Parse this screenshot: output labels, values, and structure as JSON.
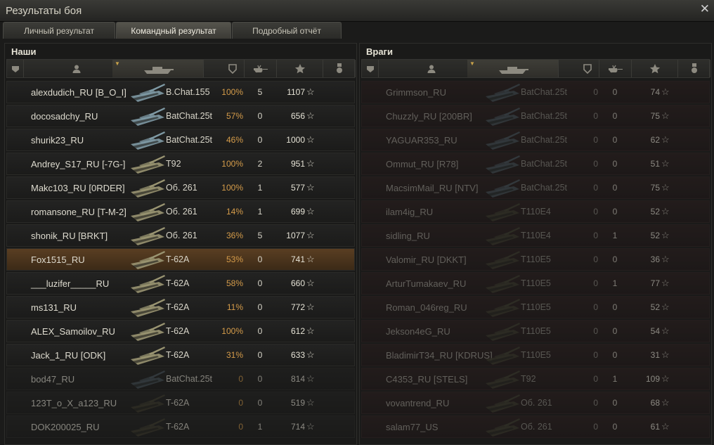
{
  "window": {
    "title": "Результаты боя"
  },
  "tabs": [
    {
      "label": "Личный результат",
      "active": false
    },
    {
      "label": "Командный результат",
      "active": true
    },
    {
      "label": "Подробный отчёт",
      "active": false
    }
  ],
  "colors": {
    "accent": "#d59c4a",
    "ally_row": "#232322",
    "enemy_row": "#2a1e1e",
    "self_row": "#5a3e22"
  },
  "header_icons": [
    "squad-icon",
    "player-icon",
    "tank-icon",
    "damage-icon",
    "frags-icon",
    "xp-star-icon",
    "medal-icon"
  ],
  "allies": {
    "label": "Наши",
    "rows": [
      {
        "name": "alexdudich_RU [B_O_I]",
        "tank": "B.Chat.155",
        "pct": "100%",
        "kills": "5",
        "xp": "1107",
        "state": "alive"
      },
      {
        "name": "docosadchy_RU",
        "tank": "BatChat.25t",
        "pct": "57%",
        "kills": "0",
        "xp": "656",
        "state": "alive"
      },
      {
        "name": "shurik23_RU",
        "tank": "BatChat.25t",
        "pct": "46%",
        "kills": "0",
        "xp": "1000",
        "state": "alive"
      },
      {
        "name": "Andrey_S17_RU [-7G-]",
        "tank": "T92",
        "pct": "100%",
        "kills": "2",
        "xp": "951",
        "state": "alive"
      },
      {
        "name": "Makc103_RU [0RDER]",
        "tank": "Об. 261",
        "pct": "100%",
        "kills": "1",
        "xp": "577",
        "state": "alive"
      },
      {
        "name": "romansone_RU [T-M-2]",
        "tank": "Об. 261",
        "pct": "14%",
        "kills": "1",
        "xp": "699",
        "state": "alive"
      },
      {
        "name": "shonik_RU [BRKT]",
        "tank": "Об. 261",
        "pct": "36%",
        "kills": "5",
        "xp": "1077",
        "state": "alive"
      },
      {
        "name": "Fox1515_RU",
        "tank": "T-62A",
        "pct": "53%",
        "kills": "0",
        "xp": "741",
        "state": "self"
      },
      {
        "name": "___luzifer_____RU",
        "tank": "T-62A",
        "pct": "58%",
        "kills": "0",
        "xp": "660",
        "state": "alive"
      },
      {
        "name": "ms131_RU",
        "tank": "T-62A",
        "pct": "11%",
        "kills": "0",
        "xp": "772",
        "state": "alive"
      },
      {
        "name": "ALEX_Samoilov_RU",
        "tank": "T-62A",
        "pct": "100%",
        "kills": "0",
        "xp": "612",
        "state": "alive"
      },
      {
        "name": "Jack_1_RU [ODK]",
        "tank": "T-62A",
        "pct": "31%",
        "kills": "0",
        "xp": "633",
        "state": "alive"
      },
      {
        "name": "bod47_RU",
        "tank": "BatChat.25t",
        "pct": "0",
        "kills": "0",
        "xp": "814",
        "state": "dead"
      },
      {
        "name": "123T_o_X_a123_RU",
        "tank": "T-62A",
        "pct": "0",
        "kills": "0",
        "xp": "519",
        "state": "dead"
      },
      {
        "name": "DOK200025_RU",
        "tank": "T-62A",
        "pct": "0",
        "kills": "1",
        "xp": "714",
        "state": "dead"
      }
    ]
  },
  "enemies": {
    "label": "Враги",
    "rows": [
      {
        "name": "Grimmson_RU",
        "tank": "BatChat.25t",
        "pct": "0",
        "kills": "0",
        "xp": "74",
        "state": "dead"
      },
      {
        "name": "Chuzzly_RU [200BR]",
        "tank": "BatChat.25t",
        "pct": "0",
        "kills": "0",
        "xp": "75",
        "state": "dead"
      },
      {
        "name": "YAGUAR353_RU",
        "tank": "BatChat.25t",
        "pct": "0",
        "kills": "0",
        "xp": "62",
        "state": "dead"
      },
      {
        "name": "Ommut_RU [R78]",
        "tank": "BatChat.25t",
        "pct": "0",
        "kills": "0",
        "xp": "51",
        "state": "dead"
      },
      {
        "name": "MacsimMail_RU [NTV]",
        "tank": "BatChat.25t",
        "pct": "0",
        "kills": "0",
        "xp": "75",
        "state": "dead"
      },
      {
        "name": "ilam4ig_RU",
        "tank": "T110E4",
        "pct": "0",
        "kills": "0",
        "xp": "52",
        "state": "dead"
      },
      {
        "name": "sidling_RU",
        "tank": "T110E4",
        "pct": "0",
        "kills": "1",
        "xp": "52",
        "state": "dead"
      },
      {
        "name": "Valomir_RU [DKKT]",
        "tank": "T110E5",
        "pct": "0",
        "kills": "0",
        "xp": "36",
        "state": "dead"
      },
      {
        "name": "ArturTumakaev_RU",
        "tank": "T110E5",
        "pct": "0",
        "kills": "1",
        "xp": "77",
        "state": "dead"
      },
      {
        "name": "Roman_046reg_RU",
        "tank": "T110E5",
        "pct": "0",
        "kills": "0",
        "xp": "52",
        "state": "dead"
      },
      {
        "name": "Jekson4eG_RU",
        "tank": "T110E5",
        "pct": "0",
        "kills": "0",
        "xp": "54",
        "state": "dead"
      },
      {
        "name": "BladimirT34_RU [KDRUS]",
        "tank": "T110E5",
        "pct": "0",
        "kills": "0",
        "xp": "31",
        "state": "dead"
      },
      {
        "name": "C4353_RU [STELS]",
        "tank": "T92",
        "pct": "0",
        "kills": "1",
        "xp": "109",
        "state": "dead"
      },
      {
        "name": "vovantrend_RU",
        "tank": "Об. 261",
        "pct": "0",
        "kills": "0",
        "xp": "68",
        "state": "dead"
      },
      {
        "name": "salam77_US",
        "tank": "Об. 261",
        "pct": "0",
        "kills": "0",
        "xp": "61",
        "state": "dead"
      }
    ]
  }
}
